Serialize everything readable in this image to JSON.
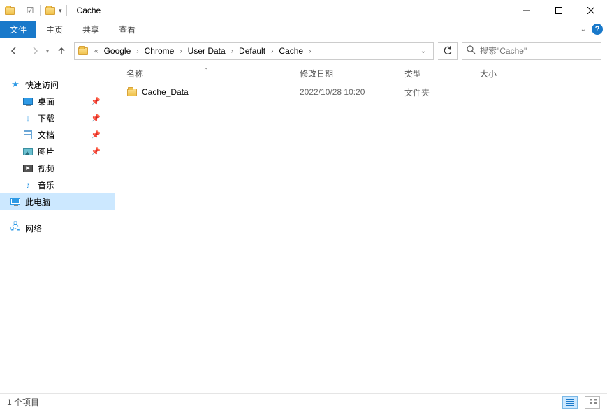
{
  "title": "Cache",
  "ribbon": {
    "file": "文件",
    "home": "主页",
    "share": "共享",
    "view": "查看"
  },
  "breadcrumbs": [
    "Google",
    "Chrome",
    "User Data",
    "Default",
    "Cache"
  ],
  "breadcrumb_prefix": "«",
  "search": {
    "placeholder": "搜索\"Cache\""
  },
  "sidebar": {
    "quick": "快速访问",
    "desktop": "桌面",
    "downloads": "下载",
    "documents": "文档",
    "pictures": "图片",
    "videos": "视频",
    "music": "音乐",
    "thispc": "此电脑",
    "network": "网络"
  },
  "columns": {
    "name": "名称",
    "date": "修改日期",
    "type": "类型",
    "size": "大小"
  },
  "rows": [
    {
      "name": "Cache_Data",
      "date": "2022/10/28 10:20",
      "type": "文件夹",
      "size": ""
    }
  ],
  "status": {
    "count": "1 个项目"
  }
}
